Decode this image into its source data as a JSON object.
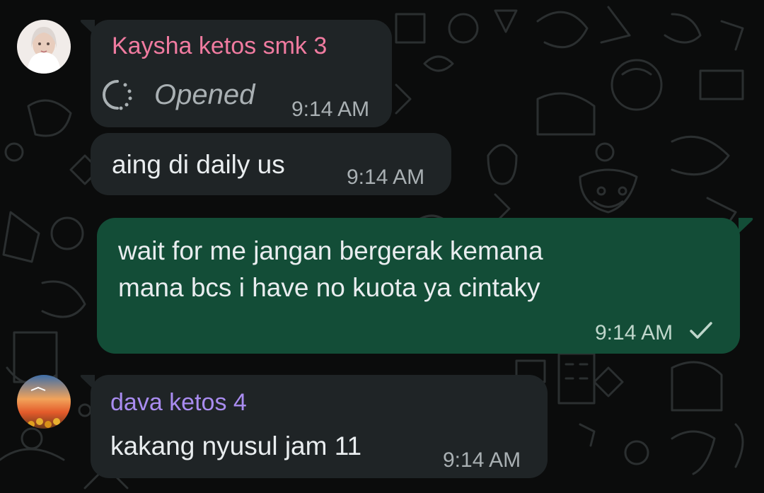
{
  "messages": [
    {
      "sender": "Kaysha ketos smk 3",
      "sender_color": "#f07ba0",
      "text": "Opened",
      "type": "view-once",
      "time": "9:14 AM"
    },
    {
      "text": "aing di daily us",
      "time": "9:14 AM"
    },
    {
      "text_lines": [
        "wait for me jangan bergerak kemana",
        "mana bcs i have no kuota ya cintaky"
      ],
      "time": "9:14 AM",
      "status_icon": "single-check-icon"
    },
    {
      "sender": "dava ketos 4",
      "sender_color": "#a98cf0",
      "text": "kakang nyusul jam 11",
      "time": "9:14 AM"
    }
  ],
  "colors": {
    "incoming_bubble": "#1f2426",
    "outgoing_bubble": "#134d37",
    "background": "#0b0c0c"
  }
}
